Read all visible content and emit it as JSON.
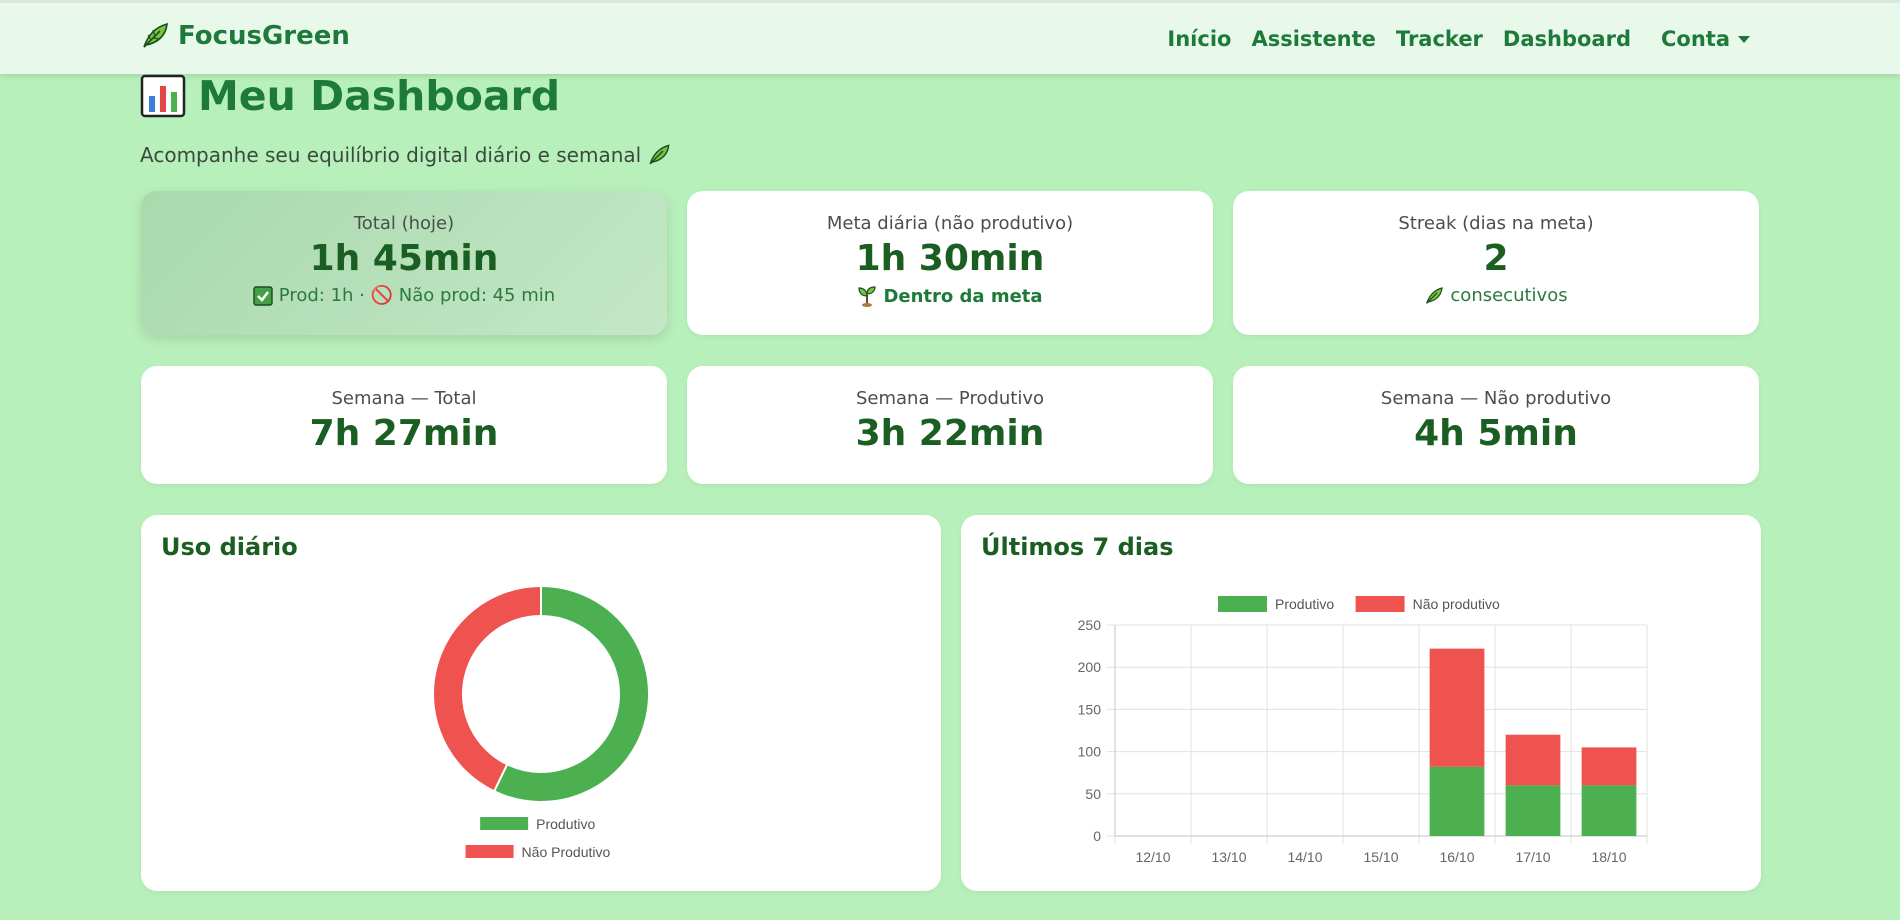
{
  "nav": {
    "brand": "FocusGreen",
    "links": [
      "Início",
      "Assistente",
      "Tracker",
      "Dashboard"
    ],
    "account": "Conta"
  },
  "header": {
    "title": "Meu Dashboard",
    "subtitle": "Acompanhe seu equilíbrio digital diário e semanal"
  },
  "today": {
    "total_label": "Total (hoje)",
    "total_value": "1h 45min",
    "breakdown": "Prod: 1h · 🚫 Não prod: 45 min",
    "goal_label": "Meta diária (não produtivo)",
    "goal_value": "1h 30min",
    "goal_status": "Dentro da meta",
    "streak_label": "Streak (dias na meta)",
    "streak_value": "2",
    "streak_foot": "consecutivos"
  },
  "week": {
    "total_label": "Semana — Total",
    "total_value": "7h 27min",
    "prod_label": "Semana — Produtivo",
    "prod_value": "3h 22min",
    "nonprod_label": "Semana — Não produtivo",
    "nonprod_value": "4h 5min"
  },
  "colors": {
    "productive": "#4caf50",
    "non_productive": "#ef5350"
  },
  "icons": {
    "brand": "leaf-icon",
    "title": "bar-chart-icon",
    "check": "check-icon",
    "forbidden": "forbidden-icon",
    "sprout": "sprout-icon",
    "leaf": "leaf-icon"
  },
  "charts": {
    "daily_title": "Uso diário",
    "weekly_title": "Últimos 7 dias"
  },
  "chart_data": [
    {
      "type": "pie",
      "title": "Uso diário",
      "labels": [
        "Produtivo",
        "Não Produtivo"
      ],
      "values": [
        60,
        45
      ]
    },
    {
      "type": "bar",
      "title": "Últimos 7 dias",
      "stacked": true,
      "categories": [
        "12/10",
        "13/10",
        "14/10",
        "15/10",
        "16/10",
        "17/10",
        "18/10"
      ],
      "series": [
        {
          "name": "Produtivo",
          "values": [
            0,
            0,
            0,
            0,
            82,
            60,
            60
          ]
        },
        {
          "name": "Não produtivo",
          "values": [
            0,
            0,
            0,
            0,
            140,
            60,
            45
          ]
        }
      ],
      "ylim": [
        0,
        250
      ],
      "yticks": [
        0,
        50,
        100,
        150,
        200,
        250
      ],
      "grid": true,
      "legend": "top"
    }
  ]
}
